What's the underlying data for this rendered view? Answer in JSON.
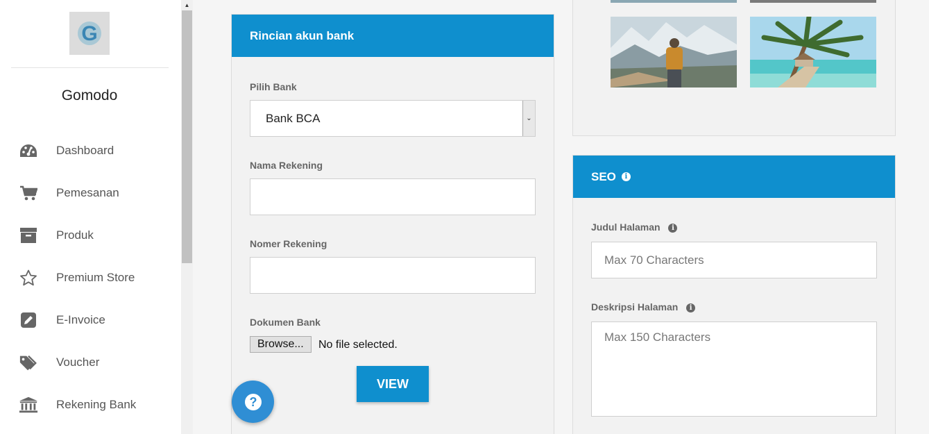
{
  "sidebar": {
    "brand": "Gomodo",
    "logo_letter": "G",
    "items": [
      {
        "label": "Dashboard",
        "icon": "dashboard-icon"
      },
      {
        "label": "Pemesanan",
        "icon": "cart-icon"
      },
      {
        "label": "Produk",
        "icon": "box-icon"
      },
      {
        "label": "Premium Store",
        "icon": "star-icon"
      },
      {
        "label": "E-Invoice",
        "icon": "edit-icon"
      },
      {
        "label": "Voucher",
        "icon": "tags-icon"
      },
      {
        "label": "Rekening Bank",
        "icon": "bank-icon"
      }
    ]
  },
  "bank_panel": {
    "title": "Rincian akun bank",
    "bank_label": "Pilih Bank",
    "bank_value": "Bank BCA",
    "account_name_label": "Nama Rekening",
    "account_name_value": "",
    "account_number_label": "Nomer Rekening",
    "account_number_value": "",
    "document_label": "Dokumen Bank",
    "browse_label": "Browse...",
    "file_status": "No file selected.",
    "view_button": "VIEW"
  },
  "seo_panel": {
    "title": "SEO",
    "page_title_label": "Judul Halaman",
    "page_title_placeholder": "Max 70 Characters",
    "page_desc_label": "Deskripsi Halaman",
    "page_desc_placeholder": "Max 150 Characters"
  },
  "colors": {
    "accent": "#0f8fce",
    "fab": "#2f8ed4",
    "sidebar_icon": "#666666"
  }
}
